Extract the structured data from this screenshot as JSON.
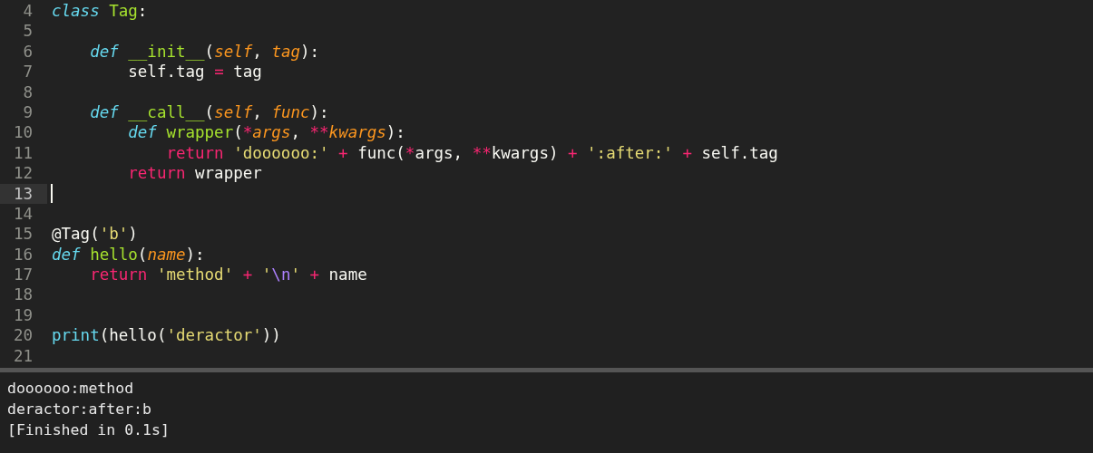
{
  "editor": {
    "lines": [
      {
        "number": "4",
        "current": false,
        "tokens": [
          {
            "text": "class",
            "kind": "keyword"
          },
          {
            "text": " Tag",
            "kind": "name"
          },
          {
            "text": ":",
            "kind": "plain"
          }
        ]
      },
      {
        "number": "5",
        "current": false
      },
      {
        "number": "6",
        "current": false,
        "tokens": [
          {
            "text": "    def",
            "kind": "keyword"
          },
          {
            "text": " __init__",
            "kind": "name"
          },
          {
            "text": "(",
            "kind": "plain"
          },
          {
            "text": "self",
            "kind": "param"
          },
          {
            "text": ", ",
            "kind": "plain"
          },
          {
            "text": "tag",
            "kind": "param"
          },
          {
            "text": "):",
            "kind": "plain"
          }
        ]
      },
      {
        "number": "7",
        "current": false,
        "tokens": [
          {
            "text": "        self.tag ",
            "kind": "plain"
          },
          {
            "text": "=",
            "kind": "operator"
          },
          {
            "text": " tag",
            "kind": "plain"
          }
        ]
      },
      {
        "number": "8",
        "current": false
      },
      {
        "number": "9",
        "current": false,
        "tokens": [
          {
            "text": "    def",
            "kind": "keyword"
          },
          {
            "text": " __call__",
            "kind": "name"
          },
          {
            "text": "(",
            "kind": "plain"
          },
          {
            "text": "self",
            "kind": "param"
          },
          {
            "text": ", ",
            "kind": "plain"
          },
          {
            "text": "func",
            "kind": "param"
          },
          {
            "text": "):",
            "kind": "plain"
          }
        ]
      },
      {
        "number": "10",
        "current": false,
        "tokens": [
          {
            "text": "        def",
            "kind": "keyword"
          },
          {
            "text": " wrapper",
            "kind": "name"
          },
          {
            "text": "(",
            "kind": "plain"
          },
          {
            "text": "*",
            "kind": "operator"
          },
          {
            "text": "args",
            "kind": "param"
          },
          {
            "text": ", ",
            "kind": "plain"
          },
          {
            "text": "**",
            "kind": "operator"
          },
          {
            "text": "kwargs",
            "kind": "param"
          },
          {
            "text": "):",
            "kind": "plain"
          }
        ]
      },
      {
        "number": "11",
        "current": false,
        "tokens": [
          {
            "text": "            return",
            "kind": "operator"
          },
          {
            "text": " 'doooooo:'",
            "kind": "string"
          },
          {
            "text": " +",
            "kind": "operator"
          },
          {
            "text": " func(",
            "kind": "plain"
          },
          {
            "text": "*",
            "kind": "operator"
          },
          {
            "text": "args, ",
            "kind": "plain"
          },
          {
            "text": "**",
            "kind": "operator"
          },
          {
            "text": "kwargs) ",
            "kind": "plain"
          },
          {
            "text": "+",
            "kind": "operator"
          },
          {
            "text": " ':after:'",
            "kind": "string"
          },
          {
            "text": " +",
            "kind": "operator"
          },
          {
            "text": " self.tag",
            "kind": "plain"
          }
        ]
      },
      {
        "number": "12",
        "current": false,
        "tokens": [
          {
            "text": "        return",
            "kind": "operator"
          },
          {
            "text": " wrapper",
            "kind": "plain"
          }
        ]
      },
      {
        "number": "13",
        "current": true
      },
      {
        "number": "14",
        "current": false
      },
      {
        "number": "15",
        "current": false,
        "tokens": [
          {
            "text": "@Tag(",
            "kind": "plain"
          },
          {
            "text": "'b'",
            "kind": "string"
          },
          {
            "text": ")",
            "kind": "plain"
          }
        ]
      },
      {
        "number": "16",
        "current": false,
        "tokens": [
          {
            "text": "def",
            "kind": "keyword"
          },
          {
            "text": " hello",
            "kind": "name"
          },
          {
            "text": "(",
            "kind": "plain"
          },
          {
            "text": "name",
            "kind": "param"
          },
          {
            "text": "):",
            "kind": "plain"
          }
        ]
      },
      {
        "number": "17",
        "current": false,
        "tokens": [
          {
            "text": "    return",
            "kind": "operator"
          },
          {
            "text": " 'method'",
            "kind": "string"
          },
          {
            "text": " +",
            "kind": "operator"
          },
          {
            "text": " '",
            "kind": "string"
          },
          {
            "text": "\\n",
            "kind": "escape"
          },
          {
            "text": "'",
            "kind": "string"
          },
          {
            "text": " +",
            "kind": "operator"
          },
          {
            "text": " name",
            "kind": "plain"
          }
        ]
      },
      {
        "number": "18",
        "current": false
      },
      {
        "number": "19",
        "current": false
      },
      {
        "number": "20",
        "current": false,
        "tokens": [
          {
            "text": "print",
            "kind": "builtin"
          },
          {
            "text": "(hello(",
            "kind": "plain"
          },
          {
            "text": "'deractor'",
            "kind": "string"
          },
          {
            "text": "))",
            "kind": "plain"
          }
        ]
      },
      {
        "number": "21",
        "current": false
      }
    ]
  },
  "output": {
    "lines": [
      "doooooo:method",
      "deractor:after:b",
      "[Finished in 0.1s]"
    ]
  }
}
